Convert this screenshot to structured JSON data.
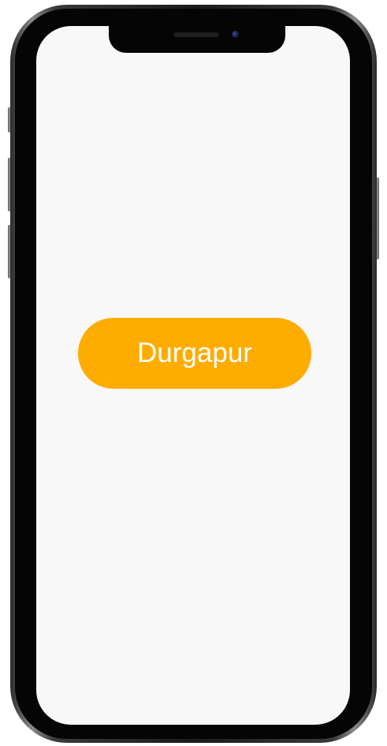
{
  "city_button": {
    "label": "Durgapur",
    "background_color": "#ffac00",
    "text_color": "#ffffff"
  },
  "screen": {
    "background_color": "#f8f8f8"
  }
}
